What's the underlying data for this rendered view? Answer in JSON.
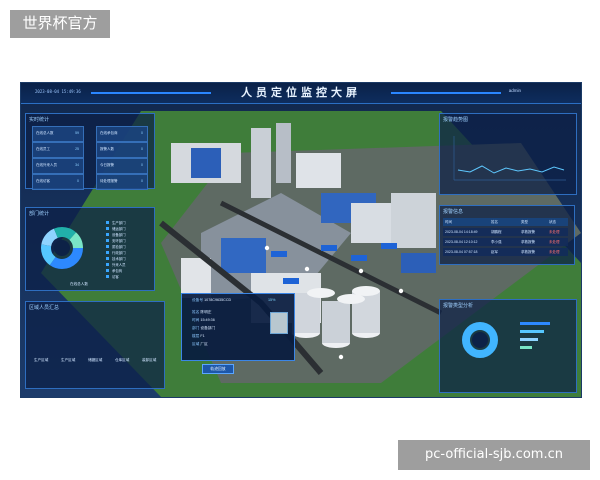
{
  "watermark_top": "世界杯官方",
  "watermark_bottom": "pc-official-sjb.com.cn",
  "header": {
    "title": "人员定位监控大屏",
    "datetime": "2023-08-04 15:49:36",
    "user": "admin"
  },
  "panels": {
    "stats": {
      "title": "实时统计",
      "cards": [
        {
          "label": "在线总人数",
          "value": "59"
        },
        {
          "label": "在线员工",
          "value": "25"
        },
        {
          "label": "在线外来人员",
          "value": "34"
        },
        {
          "label": "在线访客",
          "value": "0"
        },
        {
          "label": "在线承包商",
          "value": "0"
        },
        {
          "label": "报警人数",
          "value": "0"
        },
        {
          "label": "今日报警",
          "value": "0"
        },
        {
          "label": "待处理报警",
          "value": "0"
        }
      ]
    },
    "dept": {
      "title": "部门统计",
      "legend": [
        "生产部门",
        "储运部门",
        "设备部门",
        "安环部门",
        "质检部门",
        "行政部门",
        "技术部门",
        "外来人员",
        "承包商",
        "访客"
      ],
      "footer": "在线总人数"
    },
    "region": {
      "title": "区域人员汇总",
      "labels": [
        "生产区域",
        "生产区域",
        "储罐区域",
        "仓库区域",
        "装卸区域"
      ]
    },
    "alarm_trend": {
      "title": "报警趋势图"
    },
    "alarm_info": {
      "title": "报警信息",
      "headers": [
        "时间",
        "姓名",
        "类型",
        "状态"
      ],
      "rows": [
        [
          "2023-08-04 14:18:49",
          "胡鹏程",
          "求救报警",
          "未处理"
        ],
        [
          "2023-08-04 12:10:12",
          "李小强",
          "求救报警",
          "未处理"
        ],
        [
          "2023-08-04 07:57:18",
          "赵军",
          "求救报警",
          "未处理"
        ]
      ]
    },
    "alarm_type": {
      "title": "报警类型分析"
    }
  },
  "popup": {
    "device_label": "设备号",
    "device_id": "1078C9635CCD",
    "battery": "15%",
    "rows": [
      {
        "label": "姓名",
        "value": "陈明庄"
      },
      {
        "label": "时间",
        "value": "15:49:36"
      },
      {
        "label": "部门",
        "value": "设备部门"
      },
      {
        "label": "楼层",
        "value": "F1"
      },
      {
        "label": "区域",
        "value": "厂区"
      }
    ],
    "button": "轨迹回放"
  }
}
